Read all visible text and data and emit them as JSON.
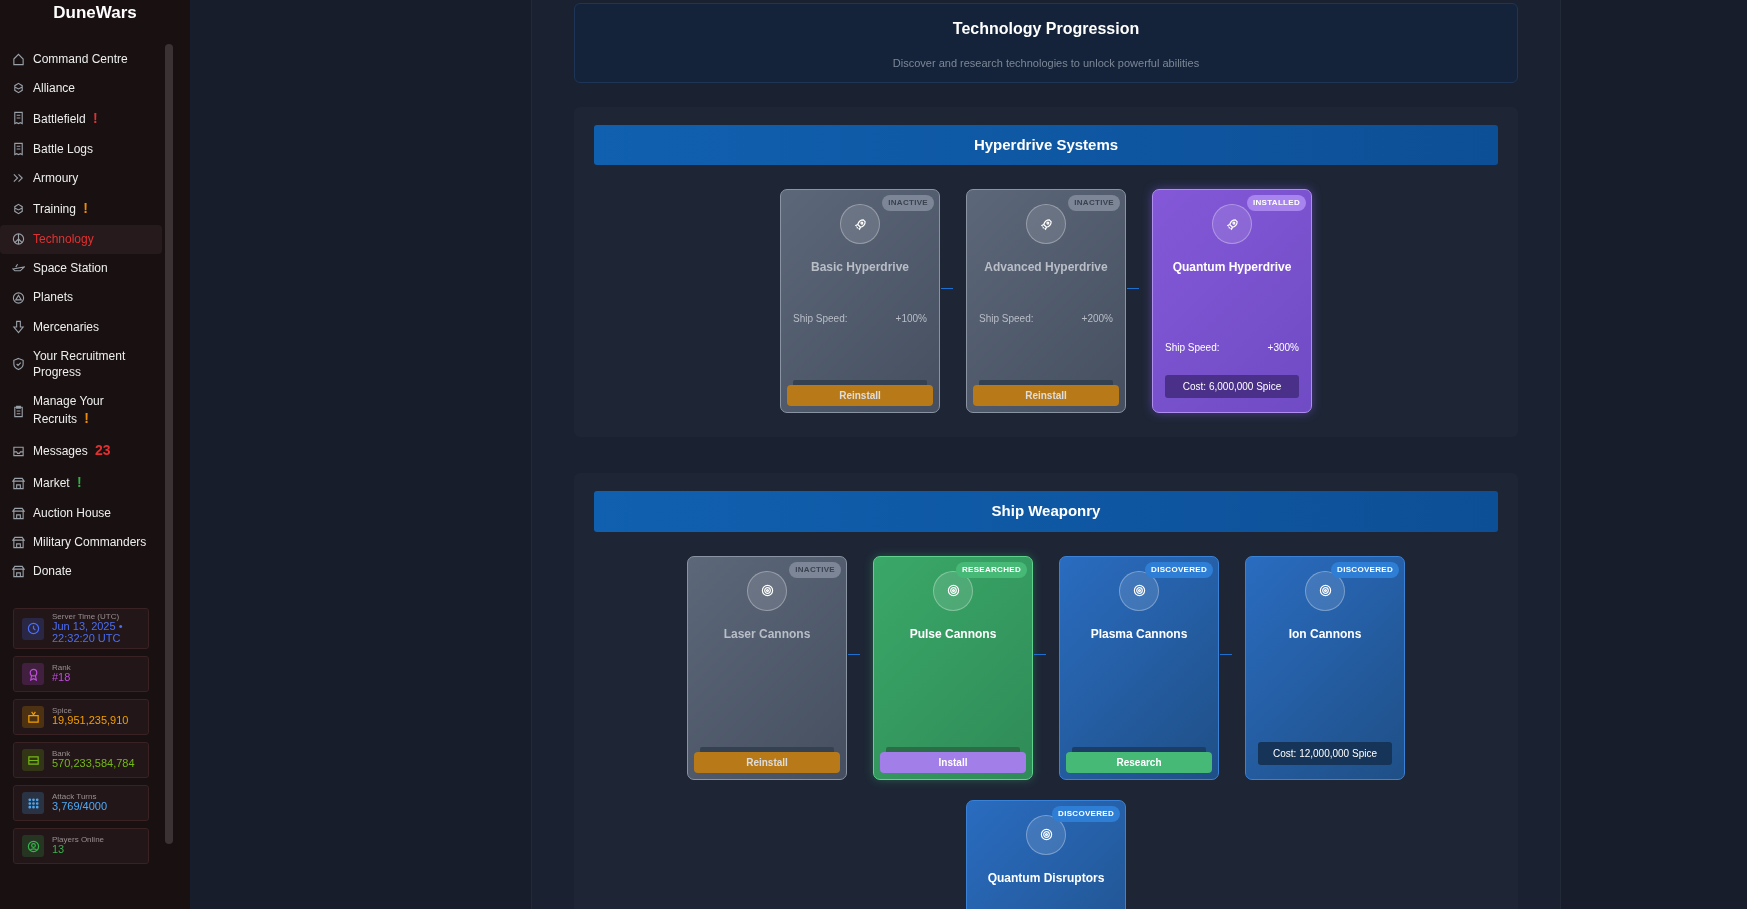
{
  "sidebar": {
    "title": "DuneWars",
    "items": [
      {
        "label": "Command Centre",
        "selected": false
      },
      {
        "label": "Alliance",
        "selected": false
      },
      {
        "label": "Battlefield",
        "selected": false,
        "badge": "!",
        "color": "#e03131"
      },
      {
        "label": "Battle Logs",
        "selected": false
      },
      {
        "label": "Armoury",
        "selected": false
      },
      {
        "label": "Training",
        "selected": false,
        "badge": "!",
        "color": "#f08c00"
      },
      {
        "label": "Technology",
        "selected": true
      },
      {
        "label": "Space Station",
        "selected": false
      },
      {
        "label": "Planets",
        "selected": false
      },
      {
        "label": "Mercenaries",
        "selected": false
      },
      {
        "label": "Your Recruitment Progress",
        "selected": false
      },
      {
        "label": "Manage Your Recruits",
        "selected": false,
        "badge": "!",
        "color": "#f08c00"
      },
      {
        "label": "Messages",
        "selected": false,
        "badge": "23",
        "color": "#e03131"
      },
      {
        "label": "Market",
        "selected": false,
        "badge": "!",
        "color": "#2fb344"
      },
      {
        "label": "Auction House",
        "selected": false
      },
      {
        "label": "Military Commanders",
        "selected": false
      },
      {
        "label": "Donate",
        "selected": false
      }
    ],
    "stats": [
      {
        "label": "Server Time (UTC)",
        "value": "Jun 13, 2025 • 22:32:20 UTC",
        "color": "#4c6ef5"
      },
      {
        "label": "Rank",
        "value": "#18",
        "color": "#be4bdb"
      },
      {
        "label": "Spice",
        "value": "19,951,235,910",
        "color": "#f59f00"
      },
      {
        "label": "Bank",
        "value": "570,233,584,784",
        "color": "#74b816"
      },
      {
        "label": "Attack Turns",
        "value": "3,769/4000",
        "color": "#4dabf7"
      },
      {
        "label": "Players Online",
        "value": "13",
        "color": "#37b24d"
      }
    ]
  },
  "header": {
    "title": "Technology Progression",
    "subtitle": "Discover and research technologies to unlock powerful abilities"
  },
  "sections": [
    {
      "title": "Hyperdrive Systems",
      "kind": "engine",
      "cards": [
        {
          "name": "Basic Hyperdrive",
          "kind": "inactive",
          "badge": "INACTIVE",
          "stat_label": "Ship Speed:",
          "stat_value": "+100%",
          "cost_covered": true,
          "action": {
            "label": "Reinstall",
            "kind": "reinstall"
          }
        },
        {
          "name": "Advanced Hyperdrive",
          "kind": "inactive",
          "badge": "INACTIVE",
          "stat_label": "Ship Speed:",
          "stat_value": "+200%",
          "cost_covered": true,
          "action": {
            "label": "Reinstall",
            "kind": "reinstall"
          }
        },
        {
          "name": "Quantum Hyperdrive",
          "kind": "installed",
          "badge": "INSTALLED",
          "stat_label": "Ship Speed:",
          "stat_value": "+300%",
          "cost": "Cost: 6,000,000 Spice"
        }
      ]
    },
    {
      "title": "Ship Weaponry",
      "kind": "weapon",
      "cards": [
        {
          "name": "Laser Cannons",
          "kind": "inactive",
          "badge": "INACTIVE",
          "cost_covered": true,
          "action": {
            "label": "Reinstall",
            "kind": "reinstall"
          }
        },
        {
          "name": "Pulse Cannons",
          "kind": "researched",
          "badge": "RESEARCHED",
          "cost_covered": true,
          "action": {
            "label": "Install",
            "kind": "install"
          }
        },
        {
          "name": "Plasma Cannons",
          "kind": "discovered",
          "badge": "DISCOVERED",
          "cost_covered": true,
          "action": {
            "label": "Research",
            "kind": "research"
          }
        },
        {
          "name": "Ion Cannons",
          "kind": "discovered",
          "badge": "DISCOVERED",
          "cost": "Cost: 12,000,000 Spice"
        },
        {
          "name": "Quantum Disruptors",
          "kind": "discovered",
          "badge": "DISCOVERED"
        }
      ]
    }
  ]
}
